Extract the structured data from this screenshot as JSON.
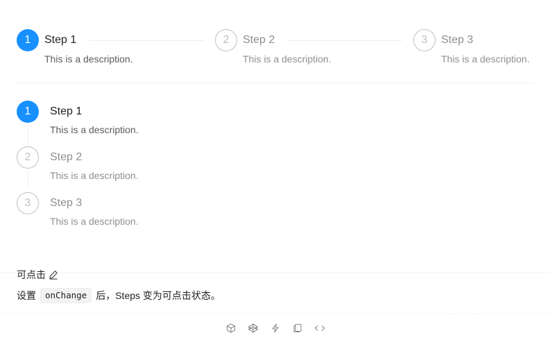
{
  "horizontal_steps": [
    {
      "number": "1",
      "title": "Step 1",
      "description": "This is a description.",
      "status": "process"
    },
    {
      "number": "2",
      "title": "Step 2",
      "description": "This is a description.",
      "status": "wait"
    },
    {
      "number": "3",
      "title": "Step 3",
      "description": "This is a description.",
      "status": "wait"
    }
  ],
  "vertical_steps": [
    {
      "number": "1",
      "title": "Step 1",
      "description": "This is a description.",
      "status": "process"
    },
    {
      "number": "2",
      "title": "Step 2",
      "description": "This is a description.",
      "status": "wait"
    },
    {
      "number": "3",
      "title": "Step 3",
      "description": "This is a description.",
      "status": "wait"
    }
  ],
  "demo": {
    "title": "可点击",
    "title_icon": "edit-icon",
    "description_prefix": "设置",
    "description_code": "onChange",
    "description_suffix": "后，Steps 变为可点击状态。"
  },
  "actions": [
    {
      "name": "codesandbox-icon"
    },
    {
      "name": "codepen-icon"
    },
    {
      "name": "stackblitz-icon"
    },
    {
      "name": "copy-icon"
    },
    {
      "name": "expand-code-icon"
    }
  ],
  "colors": {
    "primary": "#1890ff",
    "wait": "rgba(0,0,0,0.25)",
    "divider": "#f0f0f0"
  }
}
